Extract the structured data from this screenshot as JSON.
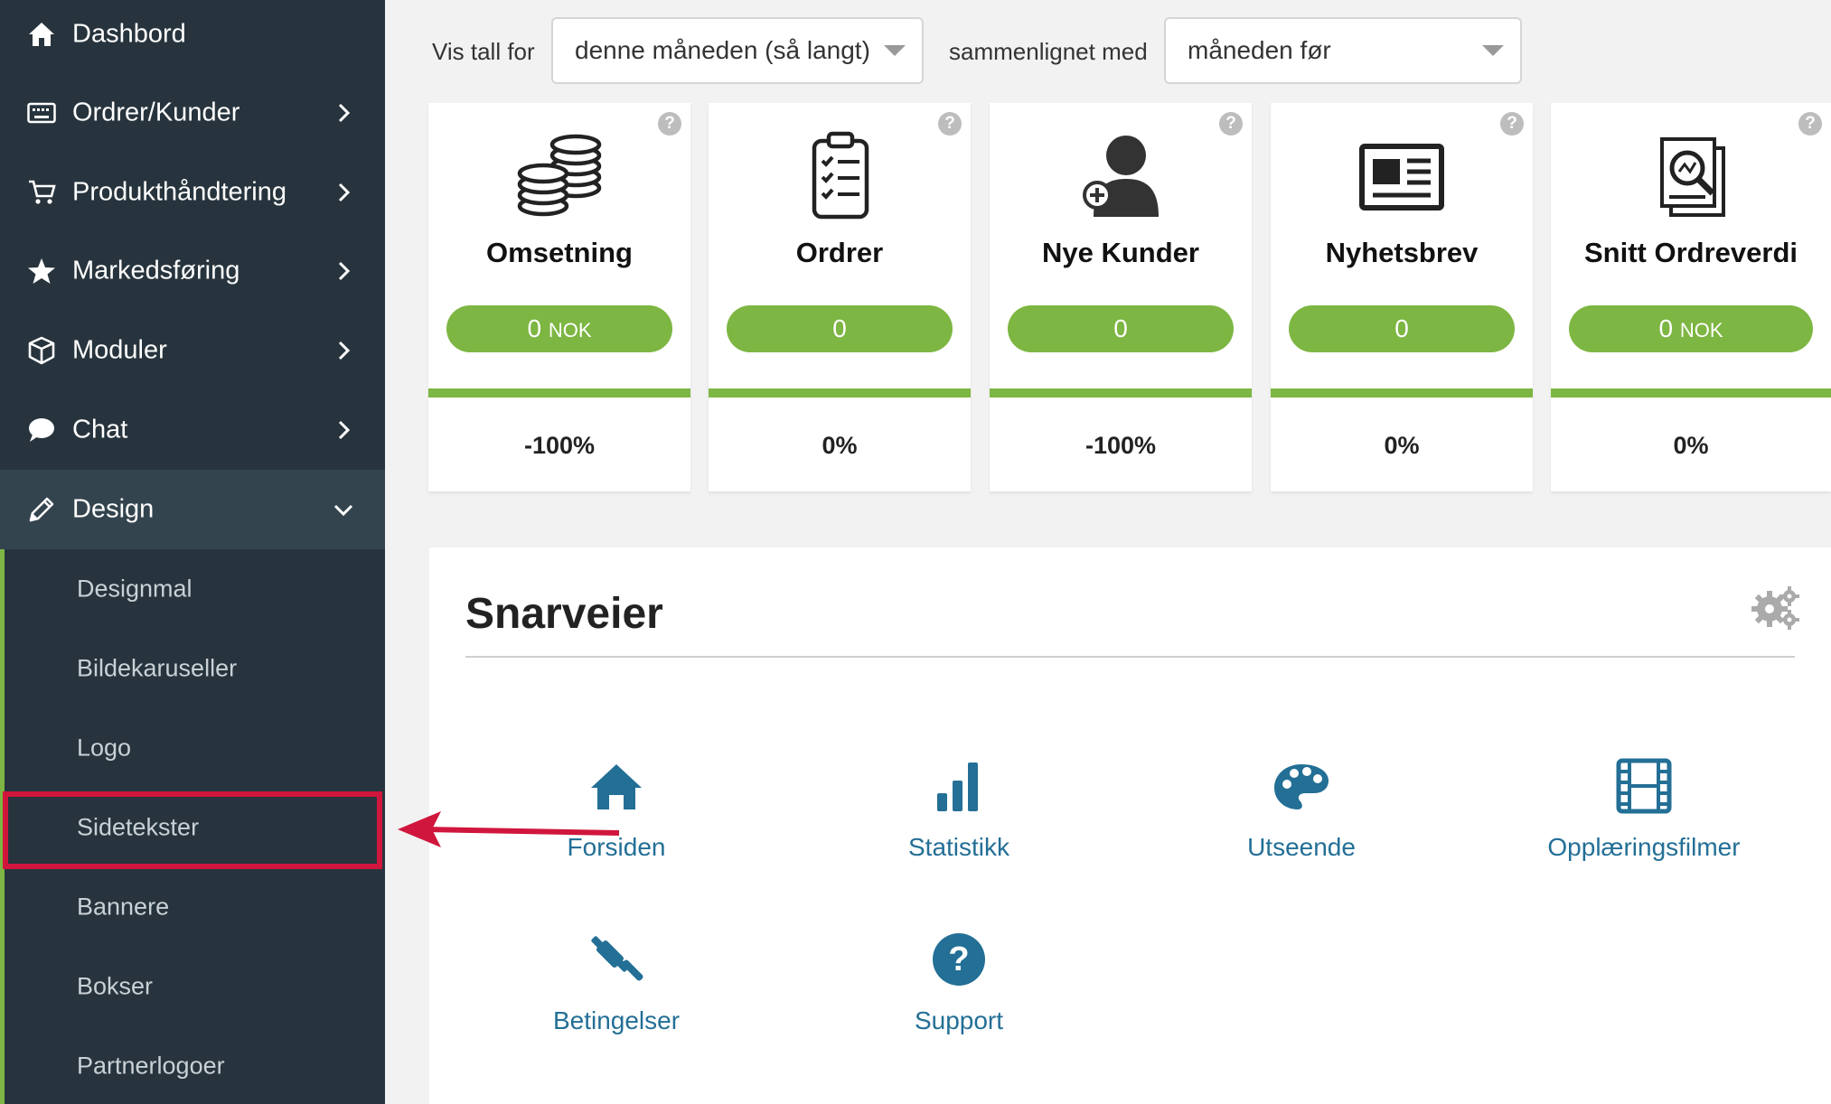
{
  "sidebar": {
    "items": [
      {
        "label": "Dashbord",
        "icon": "home-icon"
      },
      {
        "label": "Ordrer/Kunder",
        "icon": "keyboard-icon"
      },
      {
        "label": "Produkthåndtering",
        "icon": "cart-icon"
      },
      {
        "label": "Markedsføring",
        "icon": "star-icon"
      },
      {
        "label": "Moduler",
        "icon": "cube-icon"
      },
      {
        "label": "Chat",
        "icon": "chat-bubble-icon"
      },
      {
        "label": "Design",
        "icon": "pencil-icon"
      }
    ],
    "sub_items": [
      "Designmal",
      "Bildekaruseller",
      "Logo",
      "Sidetekster",
      "Bannere",
      "Bokser",
      "Partnerlogoer"
    ]
  },
  "filter": {
    "label": "Vis tall for",
    "period": "denne måneden (så langt)",
    "compare_label": "sammenlignet med",
    "compare": "måneden før"
  },
  "cards": [
    {
      "title": "Omsetning",
      "value": "0",
      "unit": "NOK",
      "change": "-100%",
      "icon": "coins-icon"
    },
    {
      "title": "Ordrer",
      "value": "0",
      "unit": "",
      "change": "0%",
      "icon": "clipboard-checklist-icon"
    },
    {
      "title": "Nye Kunder",
      "value": "0",
      "unit": "",
      "change": "-100%",
      "icon": "add-user-icon"
    },
    {
      "title": "Nyhetsbrev",
      "value": "0",
      "unit": "",
      "change": "0%",
      "icon": "newspaper-icon"
    },
    {
      "title": "Snitt Ordreverdi",
      "value": "0",
      "unit": "NOK",
      "change": "0%",
      "icon": "report-magnifier-icon"
    }
  ],
  "help_glyph": "?",
  "shortcuts": {
    "title": "Snarveier",
    "items": [
      {
        "label": "Forsiden",
        "icon": "home-icon"
      },
      {
        "label": "Statistikk",
        "icon": "bar-chart-icon"
      },
      {
        "label": "Utseende",
        "icon": "palette-icon"
      },
      {
        "label": "Opplæringsfilmer",
        "icon": "film-icon"
      },
      {
        "label": "Betingelser",
        "icon": "gavel-icon"
      },
      {
        "label": "Support",
        "icon": "question-circle-icon"
      }
    ]
  },
  "colors": {
    "sidebar_bg": "#27343d",
    "accent_green": "#7db642",
    "highlight_red": "#d0163c",
    "link_blue": "#236f96"
  }
}
